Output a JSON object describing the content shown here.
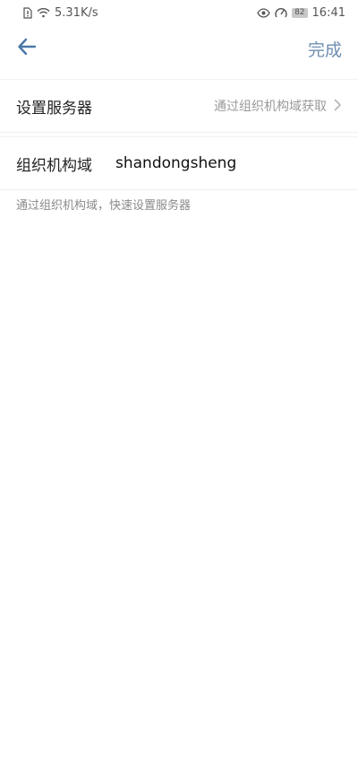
{
  "status_bar": {
    "speed": "5.31K/s",
    "battery": "82",
    "time": "16:41",
    "icons": [
      "sim-icon",
      "wifi-icon",
      "eye-icon",
      "speed-gauge-icon",
      "battery-icon"
    ]
  },
  "header": {
    "back_icon": "arrow-left-icon",
    "done_label": "完成",
    "accent_color": "#5b7fa6"
  },
  "server_row": {
    "label": "设置服务器",
    "value": "通过组织机构域获取",
    "chevron_icon": "chevron-right-icon"
  },
  "org_row": {
    "label": "组织机构域",
    "value": "shandongsheng"
  },
  "hint": "通过组织机构域，快速设置服务器"
}
